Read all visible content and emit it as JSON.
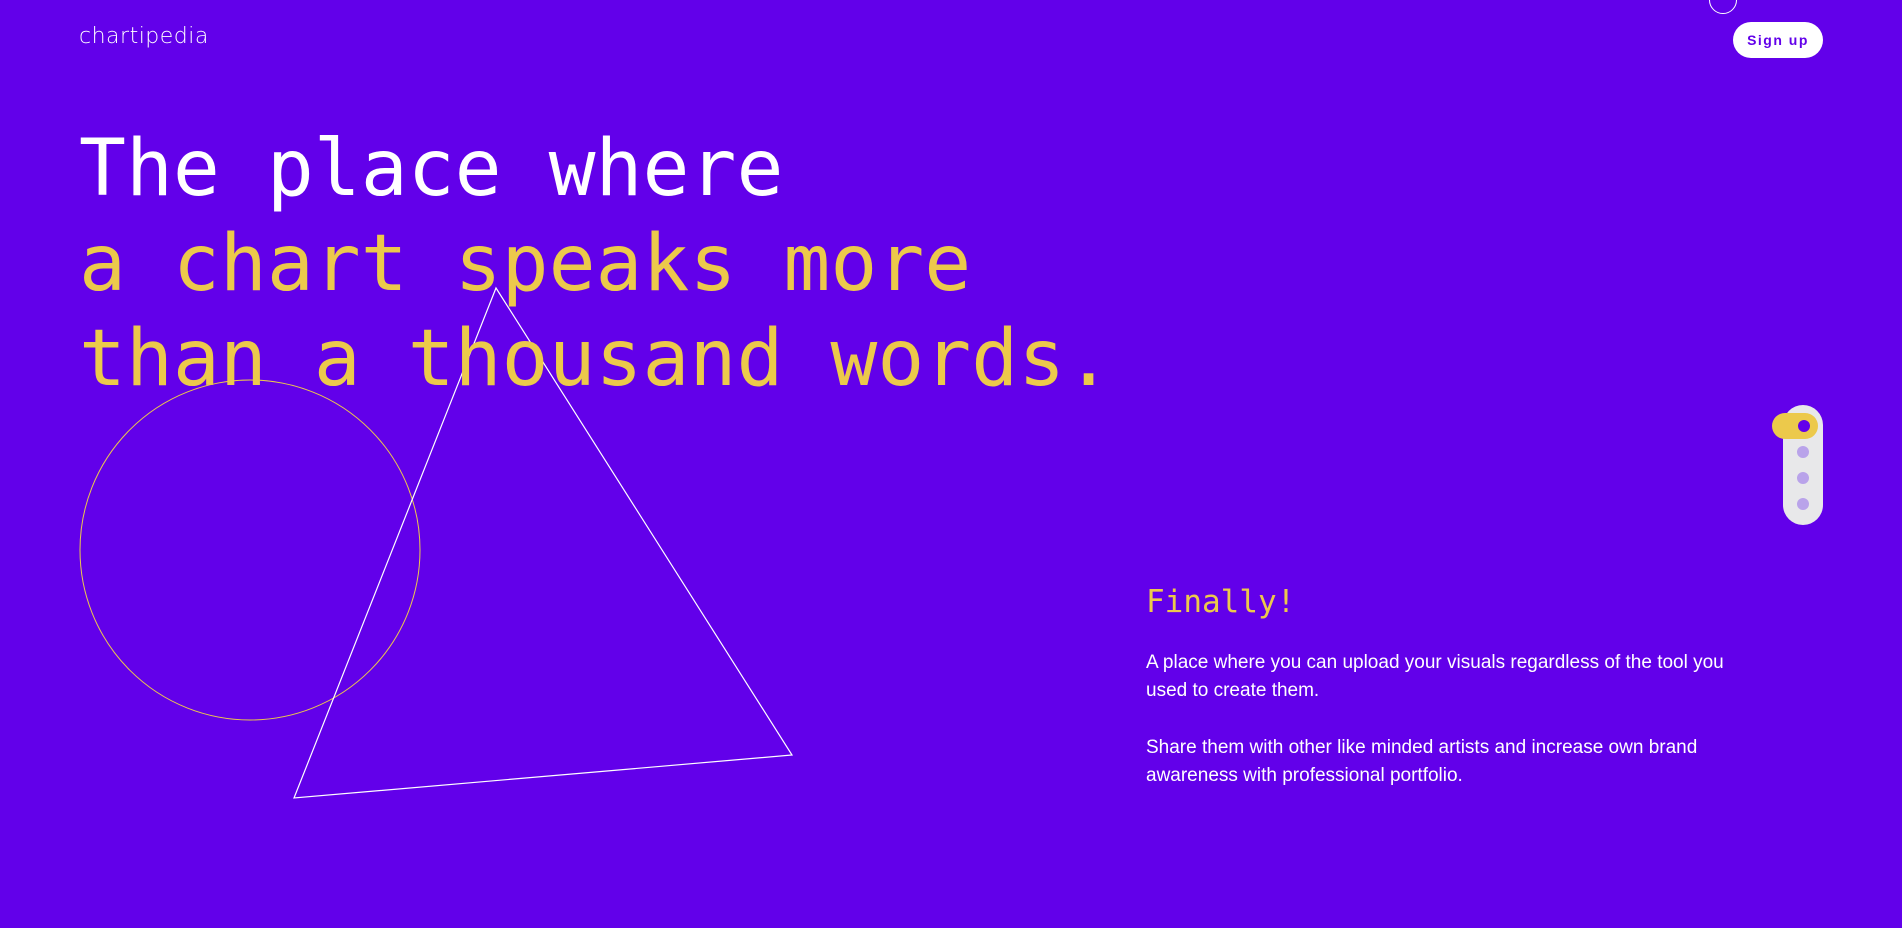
{
  "brand": {
    "name": "chartipedia"
  },
  "header": {
    "signup_label": "Sign up"
  },
  "hero": {
    "line1": "The place where",
    "line2": "a chart speaks more",
    "line3": "than a thousand words."
  },
  "intro": {
    "heading": "Finally!",
    "paragraph1": "A place where you can upload your visuals regardless of the tool you used to create them.",
    "paragraph2": "Share them with other like minded artists and increase own brand awareness with professional portfolio."
  },
  "pagination": {
    "total": 4,
    "active_index": 1
  },
  "colors": {
    "background": "#6200ea",
    "accent": "#ecc94b",
    "text": "#ffffff",
    "pager_track": "#e8e8ea",
    "pager_dot": "#b9a3ea"
  },
  "icons": {
    "logo": "chartipedia-wordmark",
    "decoration_circle": "outline-circle-icon",
    "decoration_triangle": "outline-triangle-icon"
  }
}
